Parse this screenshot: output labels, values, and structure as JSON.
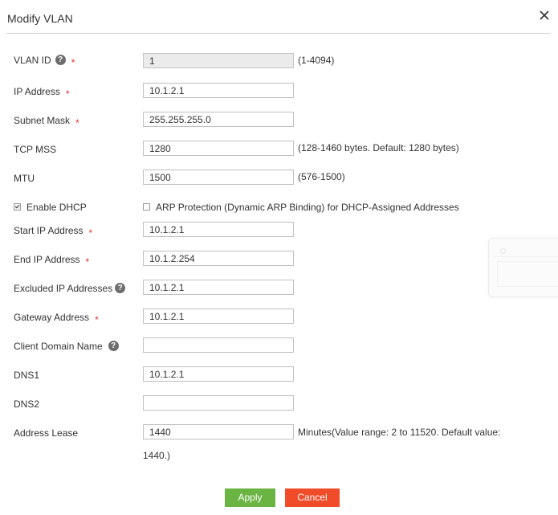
{
  "dialog": {
    "title": "Modify VLAN",
    "close_icon": "close-icon"
  },
  "fields": {
    "vlan_id": {
      "label": "VLAN ID",
      "value": "1",
      "hint": "(1-4094)",
      "required": true
    },
    "ip_address": {
      "label": "IP Address",
      "value": "10.1.2.1",
      "required": true
    },
    "subnet_mask": {
      "label": "Subnet Mask",
      "value": "255.255.255.0",
      "required": true
    },
    "tcp_mss": {
      "label": "TCP MSS",
      "value": "1280",
      "hint": "(128-1460 bytes. Default: 1280 bytes)"
    },
    "mtu": {
      "label": "MTU",
      "value": "1500",
      "hint": "(576-1500)"
    },
    "start_ip": {
      "label": "Start IP Address",
      "value": "10.1.2.1",
      "required": true
    },
    "end_ip": {
      "label": "End IP Address",
      "value": "10.1.2.254",
      "required": true
    },
    "excluded_ip": {
      "label": "Excluded IP Addresses",
      "value": "10.1.2.1"
    },
    "gateway": {
      "label": "Gateway Address",
      "value": "10.1.2.1",
      "required": true
    },
    "client_domain": {
      "label": "Client Domain Name",
      "value": ""
    },
    "dns1": {
      "label": "DNS1",
      "value": "10.1.2.1"
    },
    "dns2": {
      "label": "DNS2",
      "value": ""
    },
    "address_lease": {
      "label": "Address Lease",
      "value": "1440",
      "hint_line1": "Minutes(Value range: 2 to 11520. Default value:",
      "hint_line2": "1440.)"
    }
  },
  "checkboxes": {
    "enable_dhcp": {
      "label": "Enable DHCP",
      "checked": true
    },
    "arp_protection": {
      "label": "ARP Protection (Dynamic ARP Binding) for DHCP-Assigned Addresses",
      "checked": false
    }
  },
  "required_mark": "*",
  "help_glyph": "?",
  "buttons": {
    "apply": "Apply",
    "cancel": "Cancel"
  },
  "colors": {
    "apply": "#6ab443",
    "cancel": "#f14c2a",
    "required": "#e0312b",
    "help": "#6d6d6d"
  }
}
